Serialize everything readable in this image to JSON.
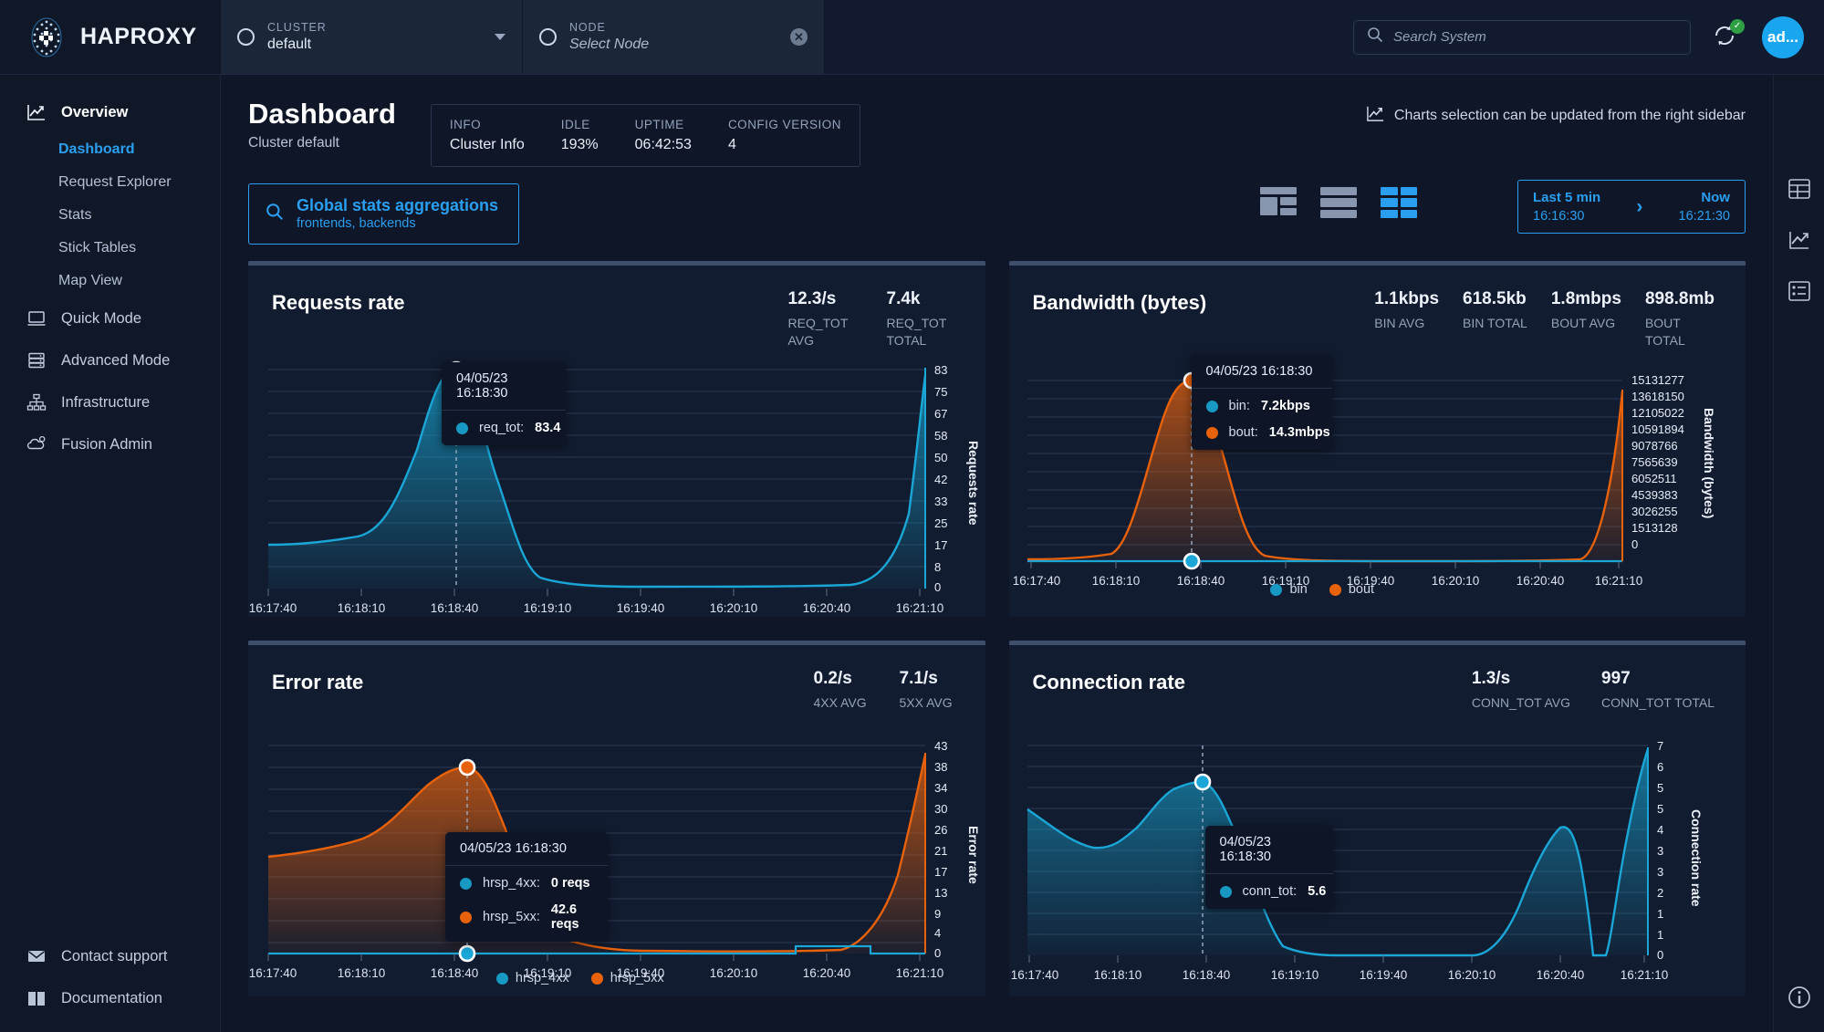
{
  "brand": {
    "name": "HAPROXY",
    "logo_icon": "haproxy-logo-icon"
  },
  "cluster_selector": {
    "label": "CLUSTER",
    "value": "default",
    "caret_icon": "chevron-down-icon",
    "ring_icon": "radio-ring-icon"
  },
  "node_selector": {
    "label": "NODE",
    "value": "Select Node",
    "clear_icon": "close-icon",
    "ring_icon": "radio-ring-icon"
  },
  "search": {
    "placeholder": "Search System",
    "icon": "search-icon"
  },
  "sync": {
    "icon": "sync-icon",
    "badge_icon": "check-icon",
    "badge_color": "#2ea043"
  },
  "avatar": {
    "label": "ad...",
    "color": "#19a6ee"
  },
  "sidebar": {
    "items": [
      {
        "label": "Overview",
        "icon": "chart-line-icon",
        "type": "root"
      },
      {
        "label": "Dashboard",
        "type": "sub",
        "active": true
      },
      {
        "label": "Request Explorer",
        "type": "sub",
        "active": false
      },
      {
        "label": "Stats",
        "type": "sub",
        "active": false
      },
      {
        "label": "Stick Tables",
        "type": "sub",
        "active": false
      },
      {
        "label": "Map View",
        "type": "sub",
        "active": false
      },
      {
        "label": "Quick Mode",
        "icon": "laptop-icon",
        "type": "root"
      },
      {
        "label": "Advanced Mode",
        "icon": "server-icon",
        "type": "root"
      },
      {
        "label": "Infrastructure",
        "icon": "sitemap-icon",
        "type": "root"
      },
      {
        "label": "Fusion Admin",
        "icon": "gear-cloud-icon",
        "type": "root"
      }
    ],
    "bottom": [
      {
        "label": "Contact support",
        "icon": "envelope-icon"
      },
      {
        "label": "Documentation",
        "icon": "book-icon"
      }
    ]
  },
  "page": {
    "title": "Dashboard",
    "subtitle": "Cluster default",
    "info_card": [
      {
        "key": "INFO",
        "value": "Cluster Info"
      },
      {
        "key": "IDLE",
        "value": "193%"
      },
      {
        "key": "UPTIME",
        "value": "06:42:53"
      },
      {
        "key": "CONFIG VERSION",
        "value": "4"
      }
    ],
    "hint": {
      "text": "Charts selection can be updated from the right sidebar",
      "icon": "chart-line-icon"
    },
    "aggregation": {
      "icon": "search-icon",
      "title": "Global stats aggregations",
      "subtitle": "frontends, backends"
    },
    "layout_buttons": [
      {
        "name": "layout-mixed-icon",
        "active": false
      },
      {
        "name": "layout-rows-icon",
        "active": false
      },
      {
        "name": "layout-grid-icon",
        "active": true
      }
    ],
    "time_range": {
      "from_label": "Last 5 min",
      "from_time": "16:16:30",
      "arrow_icon": "chevron-right-icon",
      "to_label": "Now",
      "to_time": "16:21:30"
    }
  },
  "right_rail": [
    {
      "name": "rail-panels-icon"
    },
    {
      "name": "rail-charts-icon"
    },
    {
      "name": "rail-list-icon"
    },
    {
      "name": "rail-info-icon"
    }
  ],
  "colors": {
    "blue": "#2a9ff0",
    "teal": "#1799c4",
    "orange": "#e8620c",
    "accent": "#2a9ff0"
  },
  "chart_data": [
    {
      "id": "requests-rate",
      "type": "area",
      "title": "Requests rate",
      "ylabel": "Requests rate",
      "xlabel": "",
      "stats": [
        {
          "value": "12.3/s",
          "key": "REQ_TOT AVG"
        },
        {
          "value": "7.4k",
          "key": "REQ_TOT TOTAL"
        }
      ],
      "yticks": [
        83,
        75,
        67,
        58,
        50,
        42,
        33,
        25,
        17,
        8,
        0
      ],
      "ylim": [
        0,
        83
      ],
      "xticks": [
        "16:17:40",
        "16:18:10",
        "16:18:40",
        "16:19:10",
        "16:19:40",
        "16:20:10",
        "16:20:40",
        "16:21:10"
      ],
      "grid": true,
      "legend": [],
      "series": [
        {
          "name": "req_tot",
          "color": "#1799c4",
          "values": [
            15,
            14,
            13.5,
            13,
            14,
            20,
            38,
            62,
            80,
            83.4,
            66,
            40,
            18,
            6,
            2.5,
            1.5,
            1,
            1,
            1,
            1,
            1,
            1,
            1,
            1,
            1,
            1.5,
            2,
            3,
            6,
            14,
            30,
            52,
            70,
            80
          ]
        }
      ],
      "tooltip": {
        "time": "04/05/23 16:18:30",
        "rows": [
          {
            "dot": "#1799c4",
            "key": "req_tot:",
            "value": "83.4"
          }
        ]
      }
    },
    {
      "id": "bandwidth",
      "type": "area",
      "title": "Bandwidth (bytes)",
      "ylabel": "Bandwidth (bytes)",
      "xlabel": "",
      "stats": [
        {
          "value": "1.1kbps",
          "key": "BIN AVG"
        },
        {
          "value": "618.5kb",
          "key": "BIN TOTAL"
        },
        {
          "value": "1.8mbps",
          "key": "BOUT AVG"
        },
        {
          "value": "898.8mb",
          "key": "BOUT TOTAL"
        }
      ],
      "yticks": [
        15131277,
        13618150,
        12105022,
        10591894,
        9078766,
        7565639,
        6052511,
        4539383,
        3026255,
        1513128,
        0
      ],
      "ylim": [
        0,
        15131277
      ],
      "xticks": [
        "16:17:40",
        "16:18:10",
        "16:18:40",
        "16:19:10",
        "16:19:40",
        "16:20:10",
        "16:20:40",
        "16:21:10"
      ],
      "grid": true,
      "legend": [
        {
          "name": "bin",
          "color": "#1799c4"
        },
        {
          "name": "bout",
          "color": "#e8620c"
        }
      ],
      "series": [
        {
          "name": "bin",
          "color": "#1799c4",
          "values": [
            0,
            0,
            0,
            0,
            0,
            0,
            0,
            0,
            0,
            0,
            0,
            0,
            0,
            0,
            0,
            0,
            0,
            0,
            0,
            0,
            0,
            0,
            0,
            0,
            0,
            0,
            0,
            0,
            0,
            0,
            0,
            0,
            0,
            0
          ]
        },
        {
          "name": "bout",
          "color": "#e8620c",
          "values": [
            0.5,
            0.5,
            0.5,
            0.6,
            1.2,
            3,
            6.5,
            10.5,
            13.6,
            14.3,
            11.5,
            7,
            3,
            1,
            0.4,
            0.2,
            0.1,
            0.1,
            0.1,
            0.1,
            0.1,
            0.1,
            0.1,
            0.1,
            0.1,
            0.2,
            0.4,
            0.8,
            1.6,
            3.4,
            6.4,
            9.8,
            12.6,
            14.0
          ]
        }
      ],
      "tooltip": {
        "time": "04/05/23 16:18:30",
        "rows": [
          {
            "dot": "#1799c4",
            "key": "bin:",
            "value": "7.2kbps"
          },
          {
            "dot": "#e8620c",
            "key": "bout:",
            "value": "14.3mbps"
          }
        ]
      }
    },
    {
      "id": "error-rate",
      "type": "area",
      "title": "Error rate",
      "ylabel": "Error rate",
      "xlabel": "",
      "stats": [
        {
          "value": "0.2/s",
          "key": "4XX AVG"
        },
        {
          "value": "7.1/s",
          "key": "5XX AVG"
        }
      ],
      "yticks": [
        43,
        38,
        34,
        30,
        26,
        21,
        17,
        13,
        9,
        4,
        0
      ],
      "ylim": [
        0,
        43
      ],
      "xticks": [
        "16:17:40",
        "16:18:10",
        "16:18:40",
        "16:19:10",
        "16:19:40",
        "16:20:10",
        "16:20:40",
        "16:21:10"
      ],
      "grid": true,
      "legend": [
        {
          "name": "hrsp_4xx",
          "color": "#1799c4"
        },
        {
          "name": "hrsp_5xx",
          "color": "#e8620c"
        }
      ],
      "series": [
        {
          "name": "hrsp_4xx",
          "color": "#1799c4",
          "values": [
            0,
            0,
            0,
            0,
            0,
            0,
            0,
            0,
            0,
            0,
            0,
            0,
            0,
            0,
            0,
            0,
            0,
            0,
            0,
            0,
            0,
            0,
            0,
            0,
            0,
            0,
            0,
            0,
            1.2,
            1.2,
            1.2,
            1.2,
            1.2,
            0
          ]
        },
        {
          "name": "hrsp_5xx",
          "color": "#e8620c",
          "values": [
            21,
            21.5,
            22,
            23,
            25,
            28,
            32,
            37,
            41,
            42.6,
            40,
            30,
            14,
            4,
            1,
            0.4,
            0.2,
            0.2,
            0.2,
            0.2,
            0.2,
            0.2,
            0.2,
            0.2,
            0.2,
            0.3,
            0.6,
            1.2,
            2.6,
            7,
            15,
            26,
            35,
            41
          ]
        }
      ],
      "tooltip": {
        "time": "04/05/23 16:18:30",
        "rows": [
          {
            "dot": "#1799c4",
            "key": "hrsp_4xx:",
            "value": "0 reqs"
          },
          {
            "dot": "#e8620c",
            "key": "hrsp_5xx:",
            "value": "42.6 reqs"
          }
        ]
      }
    },
    {
      "id": "connection-rate",
      "type": "area",
      "title": "Connection rate",
      "ylabel": "Connection rate",
      "xlabel": "",
      "stats": [
        {
          "value": "1.3/s",
          "key": "CONN_TOT AVG"
        },
        {
          "value": "997",
          "key": "CONN_TOT TOTAL"
        }
      ],
      "yticks": [
        7,
        6,
        5,
        5,
        4,
        3,
        3,
        2,
        1,
        1,
        0
      ],
      "ylim": [
        0,
        7
      ],
      "xticks": [
        "16:17:40",
        "16:18:10",
        "16:18:40",
        "16:19:10",
        "16:19:40",
        "16:20:10",
        "16:20:40",
        "16:21:10"
      ],
      "grid": true,
      "legend": [],
      "series": [
        {
          "name": "conn_tot",
          "color": "#1799c4",
          "values": [
            4.2,
            3.6,
            3.1,
            2.9,
            3.0,
            3.4,
            4.1,
            4.9,
            5.5,
            5.6,
            4.8,
            3.2,
            1.3,
            0.2,
            0.05,
            0,
            0,
            0,
            0,
            0,
            0,
            0,
            0,
            0,
            0.05,
            0.4,
            1.4,
            2.8,
            4.2,
            3.2,
            0,
            2.0,
            4.6,
            6.6
          ]
        }
      ],
      "tooltip": {
        "time": "04/05/23 16:18:30",
        "rows": [
          {
            "dot": "#1799c4",
            "key": "conn_tot:",
            "value": "5.6"
          }
        ]
      }
    }
  ]
}
